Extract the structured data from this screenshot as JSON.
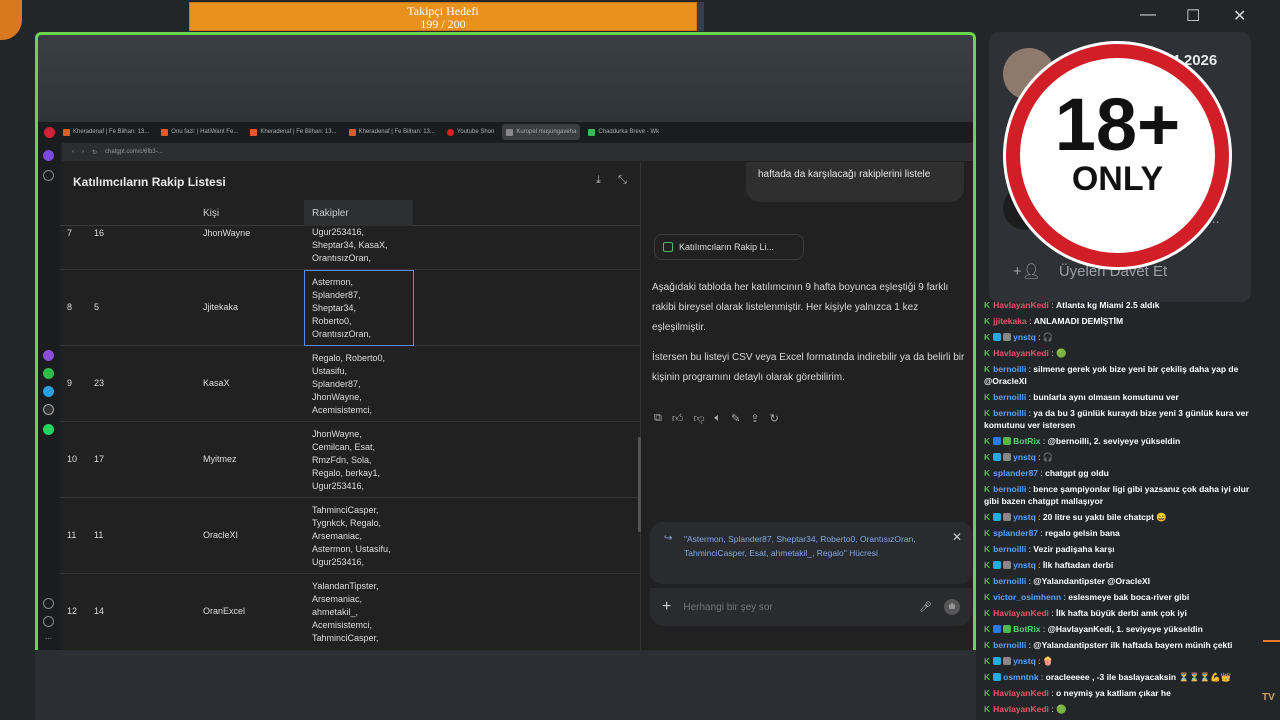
{
  "goal": {
    "title": "Takipçi Hedefi",
    "progress_text": "199 / 200",
    "fraction": 0.995
  },
  "window_controls": {
    "minimize": "—",
    "maximize": "☐",
    "close": "✕"
  },
  "browser": {
    "tabs": [
      {
        "label": "Kheradenaf | Fe Bilhan: 13..."
      },
      {
        "label": "Onu fazl: | HatiWant Fe..."
      },
      {
        "label": "Kheradenaf | Fe Bilhan: 13..."
      },
      {
        "label": "Kheradenaf | Fe Bilhan: 13..."
      },
      {
        "label": "Youtube Shon"
      },
      {
        "label": "Kuropel muşungaveha",
        "active": true
      },
      {
        "label": "Chaddurka Breve - Wk"
      }
    ],
    "url": "chatgpt.com/c/6fb3-..."
  },
  "canvas": {
    "title": "Katılımcıların Rakip Listesi",
    "columns": [
      "Kişi",
      "Rakipler"
    ],
    "rows": [
      {
        "idx": "7",
        "n": "16",
        "name": "JhonWayne",
        "rakipler": [
          "Ugur253416,",
          "Sheptar34, KasaX,",
          "OrantısızOran,"
        ]
      },
      {
        "idx": "8",
        "n": "5",
        "name": "Jjitekaka",
        "rakipler": [
          "Astermon,",
          "Splander87,",
          "Sheptar34,",
          "Roberto0,",
          "OrantısızOran,"
        ],
        "selected": true
      },
      {
        "idx": "9",
        "n": "23",
        "name": "KasaX",
        "rakipler": [
          "Regalo, Roberto0,",
          "Ustasifu,",
          "Splander87,",
          "JhonWayne,",
          "Acemisistemci,"
        ]
      },
      {
        "idx": "10",
        "n": "17",
        "name": "Myitmez",
        "rakipler": [
          "JhonWayne,",
          "Cemilcan, Esat,",
          "RmzFdn, Sola,",
          "Regalo, berkay1,",
          "Ugur253416,"
        ]
      },
      {
        "idx": "11",
        "n": "11",
        "name": "OracleXI",
        "rakipler": [
          "TahminciCasper,",
          "Tygnkck, Regalo,",
          "Arsemaniac,",
          "Astermon, Ustasifu,",
          "Ugur253416,"
        ]
      },
      {
        "idx": "12",
        "n": "14",
        "name": "OranExcel",
        "rakipler": [
          "YalandanTipster,",
          "Arsemaniac,",
          "ahmetakil_,",
          "Acemisistemci,",
          "TahminciCasper,"
        ]
      }
    ]
  },
  "chat_panel": {
    "user_message": "haftada da karşılacağı rakiplerini listele",
    "canvas_chip": "Katılımcıların Rakip Li...",
    "assistant_p1": "Aşağıdaki tabloda her katılımcının 9 hafta boyunca eşleştiği 9 farklı rakibi bireysel olarak listelenmiştir. Her kişiyle yalnızca 1 kez eşleşilmiştir.",
    "assistant_p2": "İstersen bu listeyi CSV veya Excel formatında indirebilir ya da belirli bir kişinin programını detaylı olarak görebilirim.",
    "quote": "\"Astermon, Splander87, Sheptar34, Roberto0, OrantısızOran, TahminciCasper, Esat, ahmetakil_, Regalo\" Hücresi",
    "composer_placeholder": "Herhangi bir şey sor"
  },
  "discord": {
    "date": "04.2026",
    "invite_label": "Üyeleri Davet Et",
    "truncated": "O...",
    "badge_big": "18+",
    "badge_small": "ONLY"
  },
  "chat": {
    "messages": [
      {
        "user": "HavlayanKedi",
        "color": "#e8546a",
        "text": "Atlanta kg Miami 2.5 aldık"
      },
      {
        "user": "jjitekaka",
        "color": "#e8546a",
        "text": "ANLAMADI DEMİŞTİM"
      },
      {
        "user": "ynstq",
        "color": "#5aa0ff",
        "text": "🎧",
        "badges": [
          "#2aa8e0",
          "#888"
        ]
      },
      {
        "user": "HavlayanKedi",
        "color": "#e8546a",
        "text": "🟢"
      },
      {
        "user": "bernoilli",
        "color": "#5aa0ff",
        "text": "silmene gerek yok bize yeni bir çekiliş daha yap de @OracleXI"
      },
      {
        "user": "bernoilli",
        "color": "#5aa0ff",
        "text": "bunlarla aynı olmasın komutunu ver"
      },
      {
        "user": "bernoilli",
        "color": "#5aa0ff",
        "text": "ya da bu 3 günlük kuraydı bize yeni 3 günlük kura ver komutunu ver istersen"
      },
      {
        "user": "BotRix",
        "color": "#53d86a",
        "text": "@bernoilli, 2. seviyeye yükseldin",
        "badges": [
          "#2a7be0",
          "#53b84a"
        ]
      },
      {
        "user": "ynstq",
        "color": "#5aa0ff",
        "text": "🎧",
        "badges": [
          "#2aa8e0",
          "#888"
        ]
      },
      {
        "user": "splander87",
        "color": "#5aa0ff",
        "text": "chatgpt gg oldu"
      },
      {
        "user": "bernoilli",
        "color": "#5aa0ff",
        "text": "bence şampiyonlar ligi gibi yazsanız çok daha iyi olur gibi bazen chatgpt mallaşıyor"
      },
      {
        "user": "ynstq",
        "color": "#5aa0ff",
        "text": "20 litre su yaktı bile chatcpt 😄",
        "badges": [
          "#2aa8e0",
          "#888"
        ]
      },
      {
        "user": "splander87",
        "color": "#5aa0ff",
        "text": "regalo gelsin bana"
      },
      {
        "user": "bernoilli",
        "color": "#5aa0ff",
        "text": "Vezir padişaha karşı"
      },
      {
        "user": "ynstq",
        "color": "#5aa0ff",
        "text": "İlk haftadan derbi",
        "badges": [
          "#2aa8e0",
          "#888"
        ]
      },
      {
        "user": "bernoilli",
        "color": "#5aa0ff",
        "text": "@Yalandantipster @OracleXI"
      },
      {
        "user": "victor_osimhenn",
        "color": "#5aa0ff",
        "text": "eslesmeye bak boca-river gibi"
      },
      {
        "user": "HavlayanKedi",
        "color": "#e8546a",
        "text": "İlk hafta büyük derbi amk çok iyi"
      },
      {
        "user": "BotRix",
        "color": "#53d86a",
        "text": "@HavlayanKedi, 1. seviyeye yükseldin",
        "badges": [
          "#2a7be0",
          "#53b84a"
        ]
      },
      {
        "user": "bernoilli",
        "color": "#5aa0ff",
        "text": "@Yalandantipsterr ilk haftada bayern münih çekti"
      },
      {
        "user": "ynstq",
        "color": "#5aa0ff",
        "text": "🍿",
        "badges": [
          "#2aa8e0",
          "#888"
        ]
      },
      {
        "user": "osmntnk",
        "color": "#5aa0ff",
        "text": "oracleeeee , -3 ile baslayacaksin ⏳⏳⏳💪👑",
        "badges": [
          "#2aa8e0"
        ]
      },
      {
        "user": "HavlayanKedi",
        "color": "#e8546a",
        "text": "o neymiş ya katliam çıkar he"
      },
      {
        "user": "HavlayanKedi",
        "color": "#e8546a",
        "text": "🟢"
      }
    ]
  },
  "tv_mark": "TV"
}
